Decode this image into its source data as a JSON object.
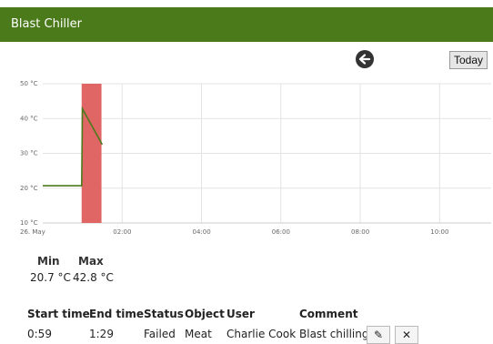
{
  "header": {
    "title": "Blast Chiller"
  },
  "toolbar": {
    "back_icon": "arrow-left-icon",
    "today_label": "Today"
  },
  "chart_data": {
    "type": "line",
    "title": "",
    "xlabel": "",
    "ylabel": "",
    "y_ticks": [
      "10 °C",
      "20 °C",
      "30 °C",
      "40 °C",
      "50 °C"
    ],
    "y_values": [
      10,
      20,
      30,
      40,
      50
    ],
    "ylim": [
      10,
      50
    ],
    "xlim": [
      0,
      11.3
    ],
    "x_ticks": [
      {
        "label": "26. May",
        "value": 0
      },
      {
        "label": "02:00",
        "value": 2
      },
      {
        "label": "04:00",
        "value": 4
      },
      {
        "label": "06:00",
        "value": 6
      },
      {
        "label": "08:00",
        "value": 8
      },
      {
        "label": "10:00",
        "value": 10
      }
    ],
    "grid": true,
    "series": [
      {
        "color": "#4b7a1b",
        "points": [
          [
            0,
            20.7
          ],
          [
            0.98,
            20.7
          ],
          [
            1.0,
            42.8
          ],
          [
            1.5,
            32.5
          ]
        ]
      }
    ],
    "highlight_band": {
      "from": 0.98,
      "to": 1.48,
      "color": "#e06565"
    }
  },
  "summary": {
    "min_label": "Min",
    "max_label": "Max",
    "min_value": "20.7 °C",
    "max_value": "42.8 °C"
  },
  "table": {
    "headers": [
      "Start time",
      "End time",
      "Status",
      "Object",
      "User",
      "Comment"
    ],
    "rows": [
      {
        "start": "0:59",
        "end": "1:29",
        "status": "Failed",
        "object": "Meat",
        "user": "Charlie Cook",
        "comment": "Blast chilling"
      }
    ],
    "actions": {
      "edit_icon": "pencil-icon",
      "delete_icon": "close-icon"
    }
  }
}
